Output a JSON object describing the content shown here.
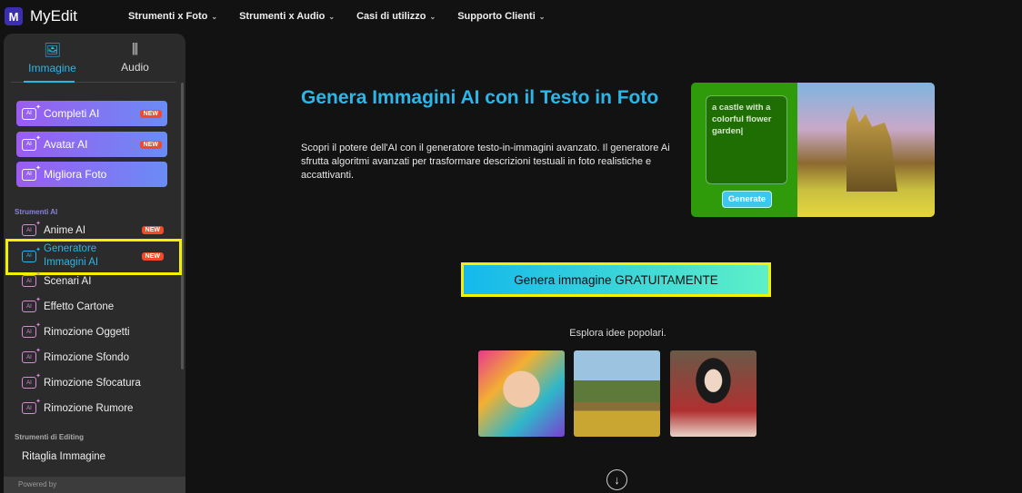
{
  "header": {
    "logo_mark": "M",
    "logo_text": "MyEdit",
    "nav": [
      "Strumenti x Foto",
      "Strumenti x Audio",
      "Casi di utilizzo",
      "Supporto Clienti"
    ]
  },
  "sidebar": {
    "tabs": [
      {
        "label": "Immagine",
        "icon": "image-icon"
      },
      {
        "label": "Audio",
        "icon": "waveform-icon"
      }
    ],
    "featured": [
      {
        "label": "Completi AI",
        "badge": "NEW"
      },
      {
        "label": "Avatar AI",
        "badge": "NEW"
      },
      {
        "label": "Migliora Foto"
      }
    ],
    "section_ai": "Strumenti AI",
    "ai_tools": [
      {
        "label": "Anime AI",
        "badge": "NEW"
      },
      {
        "label": "Generatore Immagini AI",
        "badge": "NEW"
      },
      {
        "label": "Scenari AI"
      },
      {
        "label": "Effetto Cartone"
      },
      {
        "label": "Rimozione Oggetti"
      },
      {
        "label": "Rimozione Sfondo"
      },
      {
        "label": "Rimozione Sfocatura"
      },
      {
        "label": "Rimozione Rumore"
      }
    ],
    "section_edit": "Strumenti di Editing",
    "edit_tools": [
      {
        "label": "Ritaglia Immagine"
      }
    ],
    "powered": "Powered by"
  },
  "main": {
    "title": "Genera Immagini AI con il Testo in Foto",
    "description": "Scopri il potere dell'AI con il generatore testo-in-immagini avanzato. Il generatore Ai sfrutta algoritmi avanzati per trasformare descrizioni testuali in foto realistiche e accattivanti.",
    "preview": {
      "prompt": "a castle with a colorful flower garden|",
      "button": "Generate"
    },
    "cta": "Genera immagine GRATUITAMENTE",
    "explore": "Esplora idee popolari."
  },
  "colors": {
    "accent": "#2bb6e8",
    "highlight": "#f3f000",
    "badge": "#ef4a2b"
  }
}
